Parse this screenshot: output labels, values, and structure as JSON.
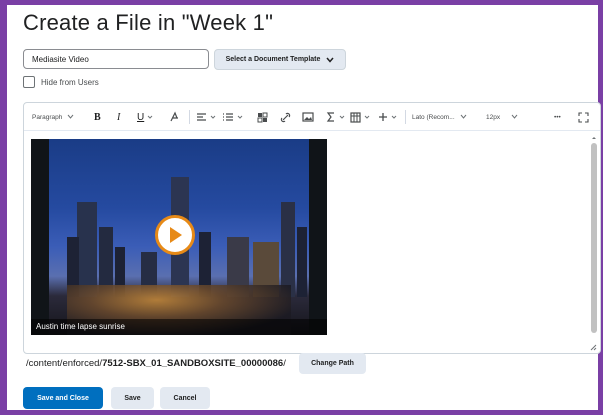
{
  "page": {
    "title": "Create a File in \"Week 1\""
  },
  "file_name": {
    "value": "Mediasite Video"
  },
  "template_button": {
    "label": "Select a Document Template"
  },
  "hide_from_users": {
    "label": "Hide from Users",
    "checked": false
  },
  "toolbar": {
    "paragraph": "Paragraph",
    "bold": "B",
    "italic": "I",
    "underline": "U",
    "font": "Lato (Recom...",
    "size": "12px",
    "more": "•••"
  },
  "video": {
    "caption": "Austin time lapse sunrise"
  },
  "path": {
    "prefix": "/content/enforced/",
    "bold": "7512-SBX_01_SANDBOXSITE_00000086",
    "suffix": "/",
    "change_label": "Change Path"
  },
  "footer": {
    "save_close": "Save and Close",
    "save": "Save",
    "cancel": "Cancel"
  },
  "colors": {
    "accent": "#006fbf",
    "frame": "#7a3fa5",
    "play_ring": "#e78a17"
  }
}
